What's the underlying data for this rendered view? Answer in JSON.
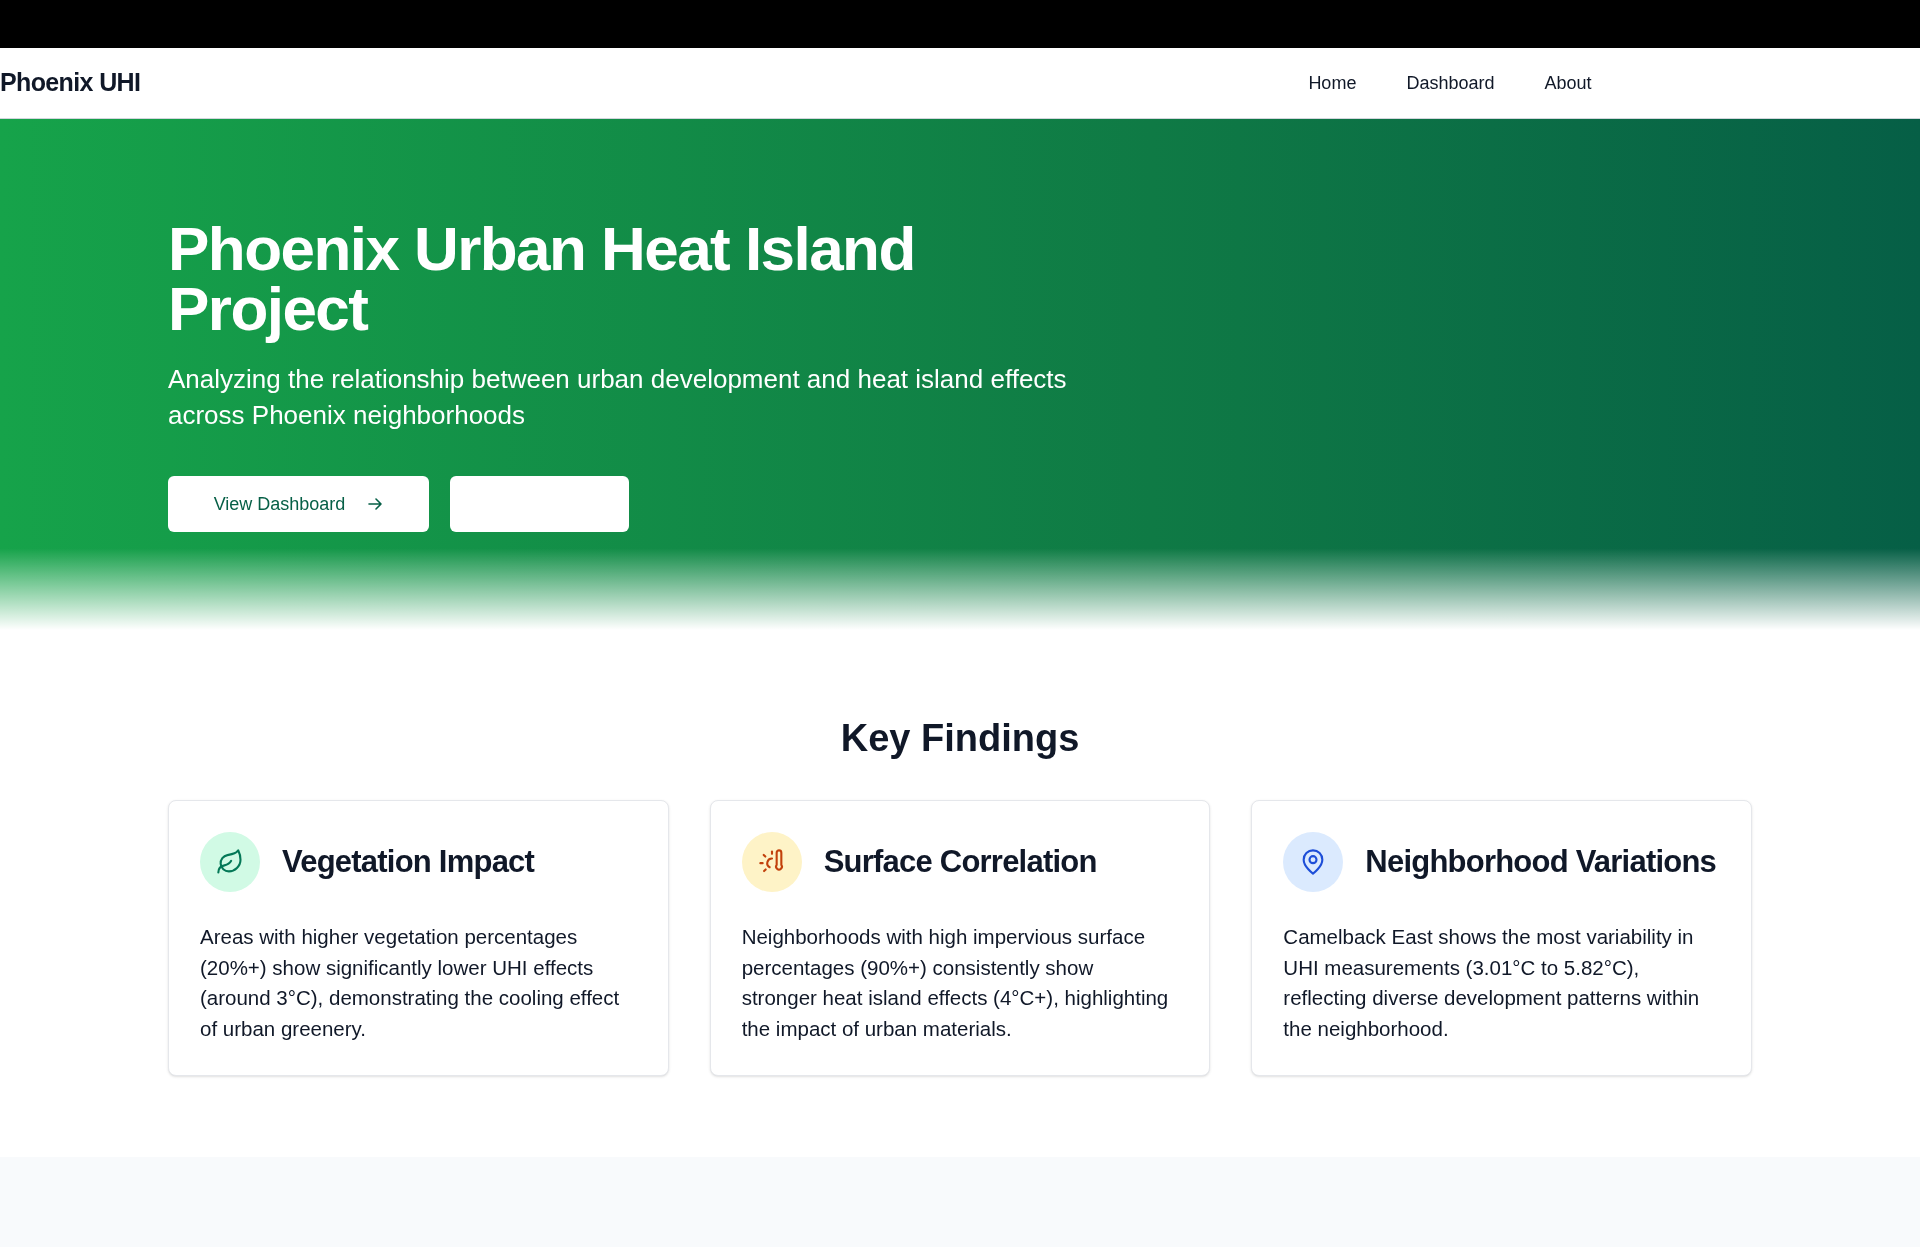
{
  "navbar": {
    "logo": "Phoenix UHI",
    "links": [
      {
        "label": "Home"
      },
      {
        "label": "Dashboard"
      },
      {
        "label": "About"
      }
    ]
  },
  "hero": {
    "title": "Phoenix Urban Heat Island Project",
    "subtitle": "Analyzing the relationship between urban development and heat island effects across Phoenix neighborhoods",
    "primary_button": "View Dashboard"
  },
  "key_findings": {
    "heading": "Key Findings",
    "cards": [
      {
        "kind": "leaf",
        "title": "Vegetation Impact",
        "text": "Areas with higher vegetation percentages (20%+) show significantly lower UHI effects (around 3°C), demonstrating the cooling effect of urban greenery."
      },
      {
        "kind": "heat",
        "title": "Surface Correlation",
        "text": "Neighborhoods with high impervious surface percentages (90%+) consistently show stronger heat island effects (4°C+), highlighting the impact of urban materials."
      },
      {
        "kind": "pin",
        "title": "Neighborhood Variations",
        "text": "Camelback East shows the most variability in UHI measurements (3.01°C to 5.82°C), reflecting diverse development patterns within the neighborhood."
      }
    ]
  }
}
